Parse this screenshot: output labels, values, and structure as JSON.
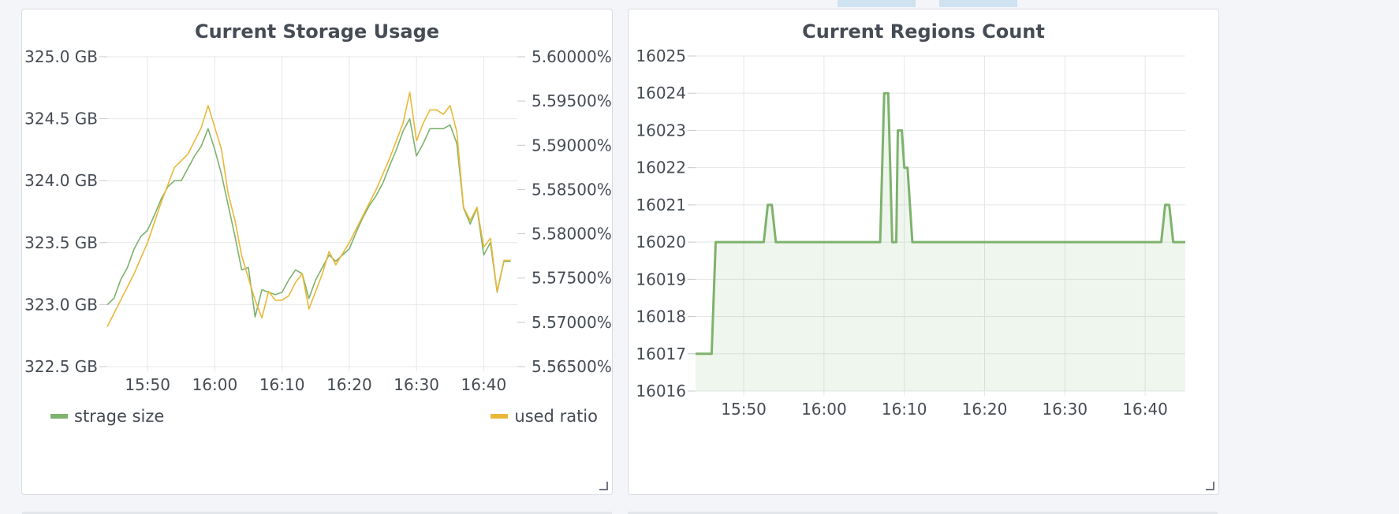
{
  "panels": [
    {
      "title": "Current Storage Usage"
    },
    {
      "title": "Current Regions Count"
    }
  ],
  "legend": {
    "left_series": "strage size",
    "right_series": "used ratio"
  },
  "colors": {
    "green": "#7eb26d",
    "orange": "#eab839",
    "grid": "#e5e7ea",
    "text": "#464c54",
    "panel_border": "#d8dce2"
  },
  "chart_data": [
    {
      "type": "line",
      "title": "Current Storage Usage",
      "x_ticks": [
        "15:50",
        "16:00",
        "16:10",
        "16:20",
        "16:30",
        "16:40"
      ],
      "xlim": [
        "15:44",
        "16:45"
      ],
      "y_left": {
        "ticks": [
          "322.5 GB",
          "323.0 GB",
          "323.5 GB",
          "324.0 GB",
          "324.5 GB",
          "325.0 GB"
        ],
        "lim": [
          322.5,
          325.0
        ],
        "unit": "GB"
      },
      "y_right": {
        "ticks": [
          "5.56500%",
          "5.57000%",
          "5.57500%",
          "5.58000%",
          "5.58500%",
          "5.59000%",
          "5.59500%",
          "5.60000%"
        ],
        "lim": [
          5.565,
          5.6
        ],
        "unit": "%"
      },
      "grid": true,
      "legend_position": "bottom",
      "series": [
        {
          "name": "strage size",
          "axis": "left",
          "color": "#7eb26d",
          "points": [
            [
              "15:44",
              323.0
            ],
            [
              "15:45",
              323.05
            ],
            [
              "15:46",
              323.2
            ],
            [
              "15:47",
              323.3
            ],
            [
              "15:48",
              323.45
            ],
            [
              "15:49",
              323.55
            ],
            [
              "15:50",
              323.6
            ],
            [
              "15:51",
              323.72
            ],
            [
              "15:52",
              323.85
            ],
            [
              "15:53",
              323.95
            ],
            [
              "15:54",
              324.0
            ],
            [
              "15:55",
              324.0
            ],
            [
              "15:56",
              324.1
            ],
            [
              "15:57",
              324.2
            ],
            [
              "15:58",
              324.28
            ],
            [
              "15:59",
              324.42
            ],
            [
              "16:00",
              324.25
            ],
            [
              "16:01",
              324.05
            ],
            [
              "16:02",
              323.8
            ],
            [
              "16:03",
              323.55
            ],
            [
              "16:04",
              323.28
            ],
            [
              "16:05",
              323.3
            ],
            [
              "16:06",
              322.9
            ],
            [
              "16:07",
              323.12
            ],
            [
              "16:08",
              323.1
            ],
            [
              "16:09",
              323.08
            ],
            [
              "16:10",
              323.1
            ],
            [
              "16:11",
              323.2
            ],
            [
              "16:12",
              323.28
            ],
            [
              "16:13",
              323.25
            ],
            [
              "16:14",
              323.05
            ],
            [
              "16:15",
              323.2
            ],
            [
              "16:16",
              323.3
            ],
            [
              "16:17",
              323.4
            ],
            [
              "16:18",
              323.35
            ],
            [
              "16:19",
              323.4
            ],
            [
              "16:20",
              323.45
            ],
            [
              "16:21",
              323.58
            ],
            [
              "16:22",
              323.7
            ],
            [
              "16:23",
              323.8
            ],
            [
              "16:24",
              323.88
            ],
            [
              "16:25",
              323.98
            ],
            [
              "16:26",
              324.12
            ],
            [
              "16:27",
              324.25
            ],
            [
              "16:28",
              324.4
            ],
            [
              "16:29",
              324.5
            ],
            [
              "16:30",
              324.2
            ],
            [
              "16:31",
              324.3
            ],
            [
              "16:32",
              324.42
            ],
            [
              "16:33",
              324.42
            ],
            [
              "16:34",
              324.42
            ],
            [
              "16:35",
              324.45
            ],
            [
              "16:36",
              324.3
            ],
            [
              "16:37",
              323.78
            ],
            [
              "16:38",
              323.65
            ],
            [
              "16:39",
              323.78
            ],
            [
              "16:40",
              323.4
            ],
            [
              "16:41",
              323.5
            ],
            [
              "16:42",
              323.1
            ],
            [
              "16:43",
              323.35
            ],
            [
              "16:44",
              323.35
            ]
          ]
        },
        {
          "name": "used ratio",
          "axis": "right",
          "color": "#eab839",
          "points": [
            [
              "15:44",
              5.5695
            ],
            [
              "15:46",
              5.5725
            ],
            [
              "15:48",
              5.5755
            ],
            [
              "15:50",
              5.579
            ],
            [
              "15:52",
              5.5835
            ],
            [
              "15:54",
              5.5875
            ],
            [
              "15:56",
              5.589
            ],
            [
              "15:58",
              5.592
            ],
            [
              "15:59",
              5.5945
            ],
            [
              "16:00",
              5.592
            ],
            [
              "16:01",
              5.5895
            ],
            [
              "16:02",
              5.5845
            ],
            [
              "16:03",
              5.5815
            ],
            [
              "16:04",
              5.5775
            ],
            [
              "16:05",
              5.575
            ],
            [
              "16:06",
              5.5725
            ],
            [
              "16:07",
              5.5705
            ],
            [
              "16:08",
              5.5735
            ],
            [
              "16:09",
              5.5725
            ],
            [
              "16:10",
              5.5725
            ],
            [
              "16:11",
              5.573
            ],
            [
              "16:12",
              5.5745
            ],
            [
              "16:13",
              5.5755
            ],
            [
              "16:14",
              5.5715
            ],
            [
              "16:15",
              5.5735
            ],
            [
              "16:16",
              5.5755
            ],
            [
              "16:17",
              5.578
            ],
            [
              "16:18",
              5.5765
            ],
            [
              "16:20",
              5.579
            ],
            [
              "16:22",
              5.582
            ],
            [
              "16:24",
              5.585
            ],
            [
              "16:26",
              5.5885
            ],
            [
              "16:28",
              5.5925
            ],
            [
              "16:29",
              5.596
            ],
            [
              "16:30",
              5.5905
            ],
            [
              "16:31",
              5.5925
            ],
            [
              "16:32",
              5.594
            ],
            [
              "16:33",
              5.594
            ],
            [
              "16:34",
              5.5935
            ],
            [
              "16:35",
              5.5945
            ],
            [
              "16:36",
              5.5915
            ],
            [
              "16:37",
              5.583
            ],
            [
              "16:38",
              5.5815
            ],
            [
              "16:39",
              5.583
            ],
            [
              "16:40",
              5.5785
            ],
            [
              "16:41",
              5.5795
            ],
            [
              "16:42",
              5.5735
            ],
            [
              "16:43",
              5.577
            ],
            [
              "16:44",
              5.577
            ]
          ]
        }
      ]
    },
    {
      "type": "area",
      "title": "Current Regions Count",
      "x_ticks": [
        "15:50",
        "16:00",
        "16:10",
        "16:20",
        "16:30",
        "16:40"
      ],
      "xlim": [
        "15:44",
        "16:45"
      ],
      "y_ticks": [
        "16016",
        "16017",
        "16018",
        "16019",
        "16020",
        "16021",
        "16022",
        "16023",
        "16024",
        "16025"
      ],
      "ylim": [
        16016,
        16025
      ],
      "grid": true,
      "series": [
        {
          "color": "#7eb26d",
          "points": [
            [
              "15:44",
              16017
            ],
            [
              "15:46",
              16017
            ],
            [
              "15:46.5",
              16020
            ],
            [
              "15:52.5",
              16020
            ],
            [
              "15:53",
              16021
            ],
            [
              "15:53.5",
              16021
            ],
            [
              "15:54",
              16020
            ],
            [
              "16:07",
              16020
            ],
            [
              "16:07.5",
              16024
            ],
            [
              "16:08",
              16024
            ],
            [
              "16:08.5",
              16020
            ],
            [
              "16:09",
              16020
            ],
            [
              "16:09.2",
              16023
            ],
            [
              "16:09.7",
              16023
            ],
            [
              "16:10",
              16022
            ],
            [
              "16:10.4",
              16022
            ],
            [
              "16:11",
              16020
            ],
            [
              "16:42",
              16020
            ],
            [
              "16:42.5",
              16021
            ],
            [
              "16:43",
              16021
            ],
            [
              "16:43.5",
              16020
            ],
            [
              "16:45",
              16020
            ]
          ]
        }
      ]
    }
  ]
}
